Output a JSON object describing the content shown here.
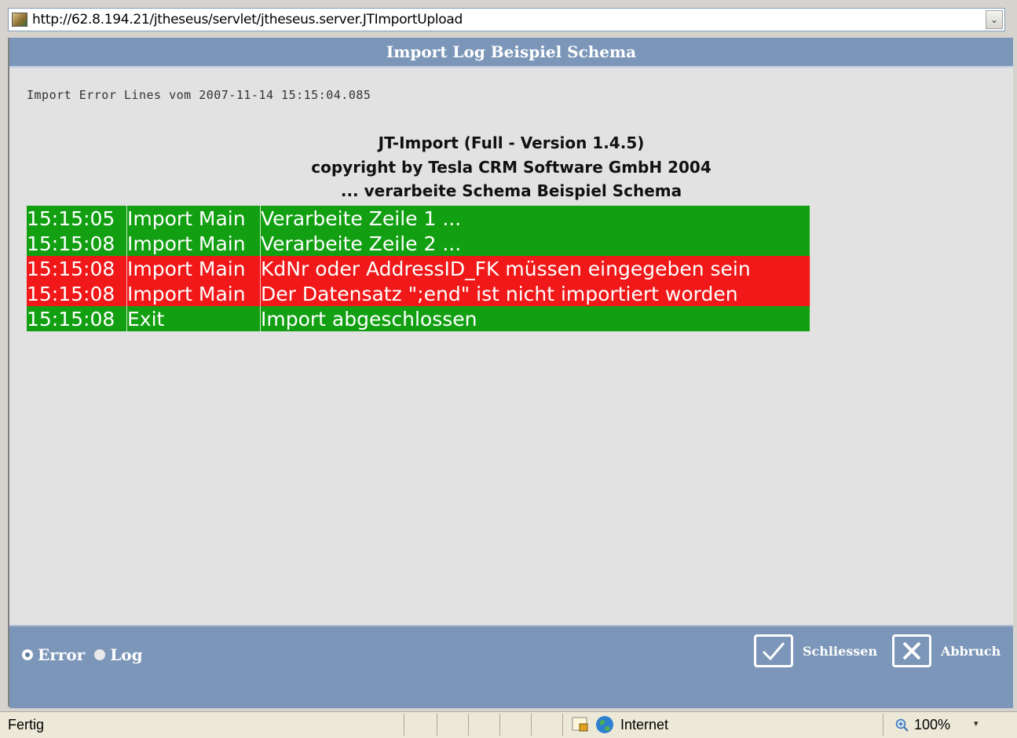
{
  "browser": {
    "url": "http://62.8.194.21/jtheseus/servlet/jtheseus.server.JTImportUpload",
    "dropdown_glyph": "⌄"
  },
  "dialog": {
    "title": "Import Log Beispiel Schema",
    "error_lines_header": "Import Error Lines vom 2007-11-14 15:15:04.085",
    "banner": [
      "JT-Import (Full - Version 1.4.5)",
      "copyright by Tesla CRM Software GmbH 2004",
      "... verarbeite Schema Beispiel Schema"
    ],
    "log_rows": [
      {
        "time": "15:15:05",
        "source": "Import Main",
        "message": "Verarbeite Zeile 1 ...",
        "status": "ok"
      },
      {
        "time": "15:15:08",
        "source": "Import Main",
        "message": "Verarbeite Zeile 2 ...",
        "status": "ok"
      },
      {
        "time": "15:15:08",
        "source": "Import Main",
        "message": "KdNr oder AddressID_FK müssen eingegeben sein",
        "status": "error"
      },
      {
        "time": "15:15:08",
        "source": "Import Main",
        "message": "Der Datensatz \";end\" ist nicht importiert worden",
        "status": "error"
      },
      {
        "time": "15:15:08",
        "source": "Exit",
        "message": "Import abgeschlossen",
        "status": "ok"
      }
    ],
    "colors": {
      "ok": "#12a012",
      "error": "#f01818",
      "header": "#7b96b8"
    }
  },
  "footer": {
    "radio_error": "Error",
    "radio_log": "Log",
    "selected_radio": "Error",
    "close_label": "Schliessen",
    "cancel_label": "Abbruch"
  },
  "statusbar": {
    "status": "Fertig",
    "zone": "Internet",
    "zoom": "100%",
    "zoom_arrow": "▾"
  }
}
